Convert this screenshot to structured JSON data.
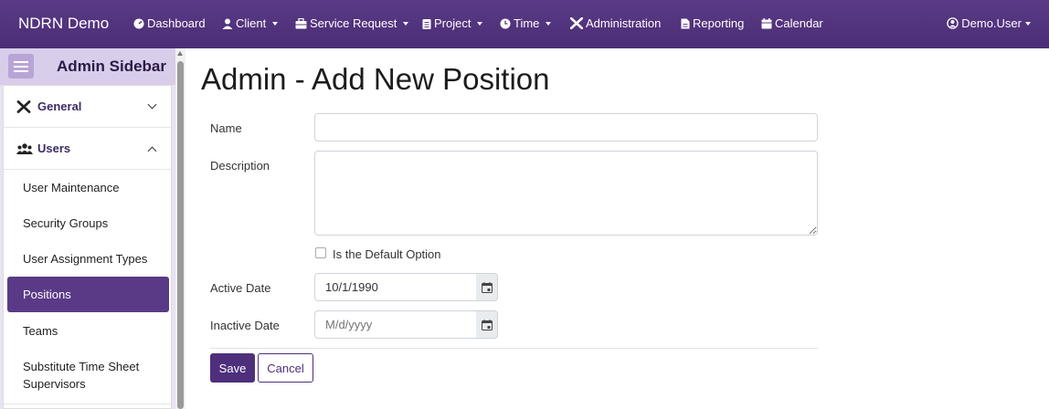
{
  "navbar": {
    "brand": "NDRN Demo",
    "items": [
      {
        "label": "Dashboard",
        "icon": "dashboard-icon",
        "dropdown": false
      },
      {
        "label": "Client",
        "icon": "person-icon",
        "dropdown": true
      },
      {
        "label": "Service Request",
        "icon": "briefcase-icon",
        "dropdown": true
      },
      {
        "label": "Project",
        "icon": "clipboard-icon",
        "dropdown": true
      },
      {
        "label": "Time",
        "icon": "clock-icon",
        "dropdown": true
      },
      {
        "label": "Administration",
        "icon": "tools-icon",
        "dropdown": false
      },
      {
        "label": "Reporting",
        "icon": "document-icon",
        "dropdown": false
      },
      {
        "label": "Calendar",
        "icon": "calendar-icon",
        "dropdown": false
      }
    ],
    "user": "Demo.User"
  },
  "sidebar": {
    "title": "Admin Sidebar",
    "groups": [
      {
        "label": "General",
        "icon": "tools-icon",
        "expanded": false
      },
      {
        "label": "Users",
        "icon": "users-icon",
        "expanded": true
      }
    ],
    "links": [
      {
        "label": "User Maintenance",
        "active": false
      },
      {
        "label": "Security Groups",
        "active": false
      },
      {
        "label": "User Assignment Types",
        "active": false
      },
      {
        "label": "Positions",
        "active": true
      },
      {
        "label": "Teams",
        "active": false
      },
      {
        "label": "Substitute Time Sheet Supervisors",
        "active": false
      }
    ]
  },
  "form": {
    "title": "Admin - Add New Position",
    "name_label": "Name",
    "name_value": "",
    "description_label": "Description",
    "description_value": "",
    "default_option_label": "Is the Default Option",
    "default_option_checked": false,
    "active_date_label": "Active Date",
    "active_date_value": "10/1/1990",
    "inactive_date_label": "Inactive Date",
    "inactive_date_placeholder": "M/d/yyyy",
    "save_label": "Save",
    "cancel_label": "Cancel"
  },
  "colors": {
    "primary": "#4e2f7c",
    "navbar": "#5a3a86",
    "sidebar_bg": "#e9e2f3"
  }
}
